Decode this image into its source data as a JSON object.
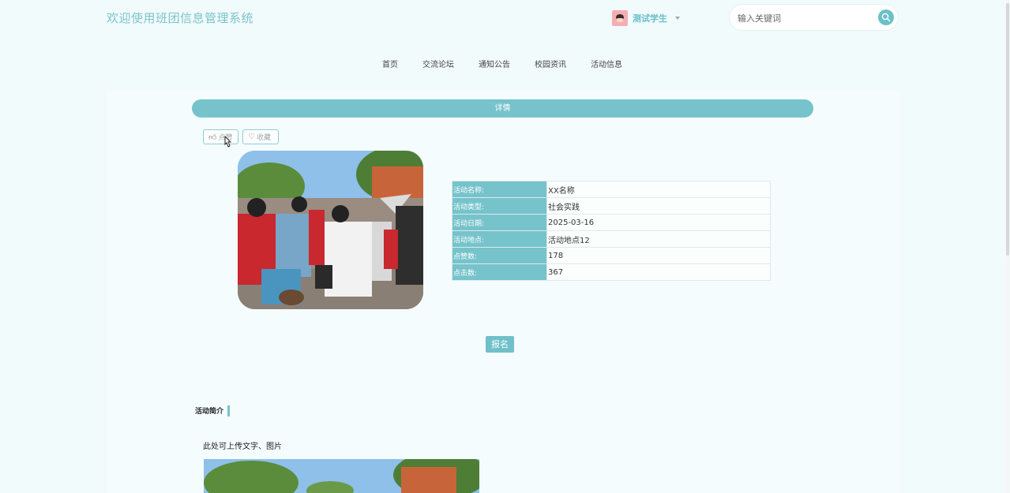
{
  "header": {
    "site_title": "欢迎使用班团信息管理系统",
    "user_name": "测试学生",
    "search_placeholder": "输入关键词"
  },
  "nav": {
    "items": [
      {
        "label": "首页"
      },
      {
        "label": "交流论坛"
      },
      {
        "label": "通知公告"
      },
      {
        "label": "校园资讯"
      },
      {
        "label": "活动信息"
      }
    ]
  },
  "detail": {
    "bar_title": "详情",
    "like_label": "点赞",
    "favorite_label": "收藏",
    "fields": [
      {
        "key": "活动名称:",
        "value": "XX名称"
      },
      {
        "key": "活动类型:",
        "value": "社会实践"
      },
      {
        "key": "活动日期:",
        "value": "2025-03-16"
      },
      {
        "key": "活动地点:",
        "value": "活动地点12"
      },
      {
        "key": "点赞数:",
        "value": "178"
      },
      {
        "key": "点击数:",
        "value": "367"
      }
    ],
    "signup_label": "报名"
  },
  "intro": {
    "section_title": "活动简介",
    "text": "此处可上传文字、图片"
  },
  "colors": {
    "accent": "#76c3cb",
    "background": "#f1fbfc",
    "title": "#7cc3cb"
  }
}
